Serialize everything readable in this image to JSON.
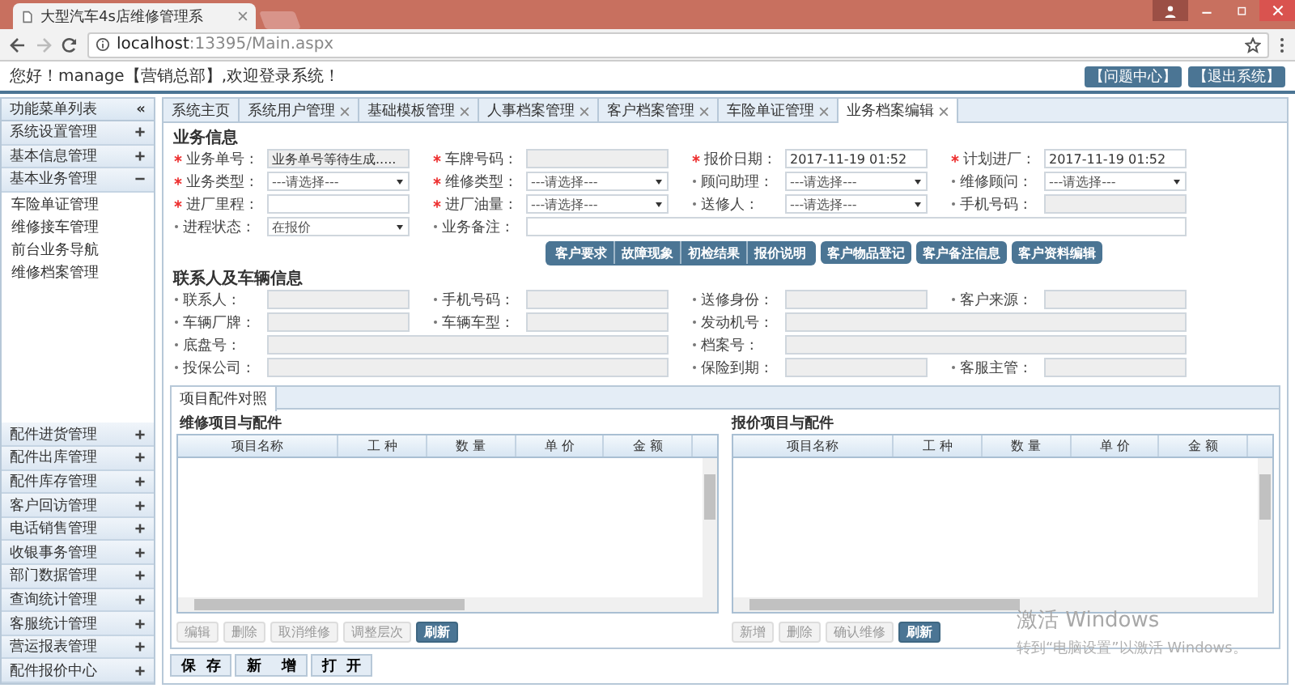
{
  "browser": {
    "tab_title": "大型汽车4s店维修管理系",
    "url_host": "localhost",
    "url_rest": ":13395/Main.aspx"
  },
  "header": {
    "greeting": "您好！manage【营销总部】,欢迎登录系统！",
    "buttons": [
      "【问题中心】",
      "【退出系统】"
    ]
  },
  "sidebar": {
    "title": "功能菜单列表",
    "collapse": "«",
    "groups": [
      {
        "label": "系统设置管理",
        "expanded": false
      },
      {
        "label": "基本信息管理",
        "expanded": false
      },
      {
        "label": "基本业务管理",
        "expanded": true,
        "children": [
          "车险单证管理",
          "维修接车管理",
          "前台业务导航",
          "维修档案管理"
        ]
      },
      {
        "label": "配件进货管理",
        "expanded": false
      },
      {
        "label": "配件出库管理",
        "expanded": false
      },
      {
        "label": "配件库存管理",
        "expanded": false
      },
      {
        "label": "客户回访管理",
        "expanded": false
      },
      {
        "label": "电话销售管理",
        "expanded": false
      },
      {
        "label": "收银事务管理",
        "expanded": false
      },
      {
        "label": "部门数据管理",
        "expanded": false
      },
      {
        "label": "查询统计管理",
        "expanded": false
      },
      {
        "label": "客服统计管理",
        "expanded": false
      },
      {
        "label": "营运报表管理",
        "expanded": false
      },
      {
        "label": "配件报价中心",
        "expanded": false
      }
    ]
  },
  "tabs": [
    {
      "label": "系统主页",
      "closable": false,
      "selected": false
    },
    {
      "label": "系统用户管理",
      "closable": true,
      "selected": false
    },
    {
      "label": "基础模板管理",
      "closable": true,
      "selected": false
    },
    {
      "label": "人事档案管理",
      "closable": true,
      "selected": false
    },
    {
      "label": "客户档案管理",
      "closable": true,
      "selected": false
    },
    {
      "label": "车险单证管理",
      "closable": true,
      "selected": false
    },
    {
      "label": "业务档案编辑",
      "closable": true,
      "selected": true
    }
  ],
  "business": {
    "title": "业务信息",
    "rows": [
      [
        {
          "label": "业务单号 :",
          "required": true,
          "kind": "readonly",
          "value": "业务单号等待生成....."
        },
        {
          "label": "车牌号码 :",
          "required": true,
          "kind": "readonly"
        },
        {
          "label": "报价日期 :",
          "required": true,
          "kind": "text",
          "value": "2017-11-19 01:52"
        },
        {
          "label": "计划进厂 :",
          "required": true,
          "kind": "text",
          "value": "2017-11-19 01:52"
        }
      ],
      [
        {
          "label": "业务类型 :",
          "required": true,
          "kind": "select",
          "value": "---请选择---"
        },
        {
          "label": "维修类型 :",
          "required": true,
          "kind": "select",
          "value": "---请选择---"
        },
        {
          "label": "顾问助理 :",
          "required": false,
          "kind": "select",
          "value": "---请选择---"
        },
        {
          "label": "维修顾问 :",
          "required": false,
          "kind": "select",
          "value": "---请选择---"
        }
      ],
      [
        {
          "label": "进厂里程 :",
          "required": true,
          "kind": "text"
        },
        {
          "label": "进厂油量 :",
          "required": true,
          "kind": "select",
          "value": "---请选择---"
        },
        {
          "label": "送修人 :",
          "required": false,
          "kind": "select",
          "value": "---请选择---"
        },
        {
          "label": "手机号码 :",
          "required": false,
          "kind": "readonly"
        }
      ],
      [
        {
          "label": "进程状态 :",
          "required": false,
          "kind": "select",
          "value": "在报价"
        },
        {
          "label": "业务备注 :",
          "required": false,
          "kind": "text"
        },
        "",
        ""
      ]
    ],
    "actions": [
      {
        "kind": "segmented",
        "items": [
          "客户要求",
          "故障现象",
          "初检结果",
          "报价说明"
        ]
      },
      {
        "kind": "single",
        "items": [
          "客户物品登记"
        ]
      },
      {
        "kind": "single",
        "items": [
          "客户备注信息"
        ]
      },
      {
        "kind": "single",
        "items": [
          "客户资料编辑"
        ]
      }
    ]
  },
  "contact": {
    "title": "联系人及车辆信息",
    "rows": [
      [
        {
          "label": "联系人 :",
          "required": false,
          "kind": "readonly"
        },
        {
          "label": "手机号码 :",
          "required": false,
          "kind": "readonly"
        },
        {
          "label": "送修身份 :",
          "required": false,
          "kind": "readonly"
        },
        {
          "label": "客户来源 :",
          "required": false,
          "kind": "readonly"
        }
      ],
      [
        {
          "label": "车辆厂牌 :",
          "required": false,
          "kind": "readonly"
        },
        {
          "label": "车辆车型 :",
          "required": false,
          "kind": "readonly"
        },
        {
          "label": "发动机号 :",
          "required": false,
          "kind": "readonly"
        },
        ""
      ],
      [
        {
          "label": "底盘号 :",
          "required": false,
          "kind": "readonly"
        },
        "",
        {
          "label": "档案号 :",
          "required": false,
          "kind": "readonly"
        },
        ""
      ],
      [
        {
          "label": "投保公司 :",
          "required": false,
          "kind": "readonly"
        },
        "",
        {
          "label": "保险到期 :",
          "required": false,
          "kind": "readonly"
        },
        {
          "label": "客服主管 :",
          "required": false,
          "kind": "readonly"
        }
      ]
    ]
  },
  "parts": {
    "tabs": [
      {
        "label": "项目配件对照",
        "selected": true
      }
    ],
    "grids": [
      {
        "title": "维修项目与配件",
        "columns": [
          "项目名称",
          "工 种",
          "数 量",
          "单 价",
          "金 额"
        ],
        "buttons": [
          {
            "label": "编辑",
            "kind": "plain"
          },
          {
            "label": "删除",
            "kind": "plain"
          },
          {
            "label": "取消维修",
            "kind": "plain"
          },
          {
            "label": "调整层次",
            "kind": "plain"
          },
          {
            "label": "刷新",
            "kind": "primary"
          }
        ]
      },
      {
        "title": "报价项目与配件",
        "columns": [
          "项目名称",
          "工 种",
          "数 量",
          "单 价",
          "金 额"
        ],
        "buttons": [
          {
            "label": "新增",
            "kind": "plain"
          },
          {
            "label": "删除",
            "kind": "plain"
          },
          {
            "label": "确认维修",
            "kind": "plain"
          },
          {
            "label": "刷新",
            "kind": "primary"
          }
        ]
      }
    ]
  },
  "footer_buttons": [
    "保  存",
    "新    增",
    "打  开"
  ],
  "activation": {
    "title": "激活 Windows",
    "hint": "转到“电脑设置”以激活 Windows。"
  }
}
